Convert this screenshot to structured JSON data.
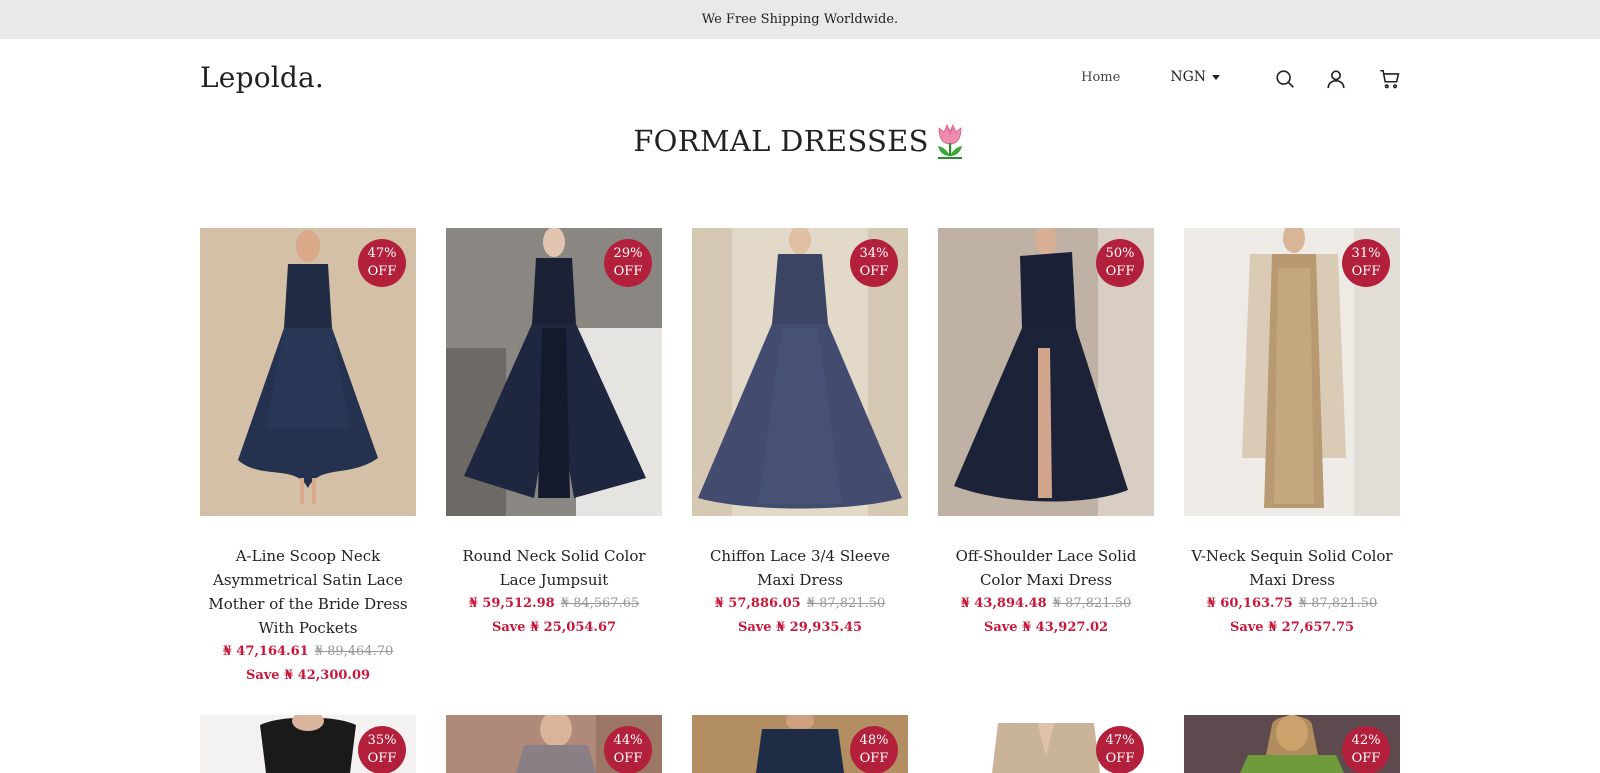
{
  "announcement": "We Free Shipping Worldwide.",
  "header": {
    "logo": "Lepolda.",
    "nav_home": "Home",
    "currency": "NGN",
    "icons": [
      "search-icon",
      "account-icon",
      "cart-icon"
    ]
  },
  "collection_title": "FORMAL DRESSES",
  "colors": {
    "badge": "#b3203c",
    "price": "#c8183a",
    "announcement_bg": "#e9e9e9"
  },
  "products": [
    {
      "badge_pct": "47%",
      "badge_off": "OFF",
      "title": "A-Line Scoop Neck Asymmetrical Satin Lace Mother of the Bride Dress With Pockets",
      "price": "₦ 47,164.61",
      "compare_price": "₦ 89,464.70",
      "save": "Save ₦ 42,300.09"
    },
    {
      "badge_pct": "29%",
      "badge_off": "OFF",
      "title": "Round Neck Solid Color Lace Jumpsuit",
      "price": "₦ 59,512.98",
      "compare_price": "₦ 84,567.65",
      "save": "Save ₦ 25,054.67"
    },
    {
      "badge_pct": "34%",
      "badge_off": "OFF",
      "title": "Chiffon Lace 3/4 Sleeve Maxi Dress",
      "price": "₦ 57,886.05",
      "compare_price": "₦ 87,821.50",
      "save": "Save ₦ 29,935.45"
    },
    {
      "badge_pct": "50%",
      "badge_off": "OFF",
      "title": "Off-Shoulder Lace Solid Color Maxi Dress",
      "price": "₦ 43,894.48",
      "compare_price": "₦ 87,821.50",
      "save": "Save ₦ 43,927.02"
    },
    {
      "badge_pct": "31%",
      "badge_off": "OFF",
      "title": "V-Neck Sequin Solid Color Maxi Dress",
      "price": "₦ 60,163.75",
      "compare_price": "₦ 87,821.50",
      "save": "Save ₦ 27,657.75"
    }
  ],
  "products_row2": [
    {
      "badge_pct": "35%",
      "badge_off": "OFF"
    },
    {
      "badge_pct": "44%",
      "badge_off": "OFF"
    },
    {
      "badge_pct": "48%",
      "badge_off": "OFF"
    },
    {
      "badge_pct": "47%",
      "badge_off": "OFF"
    },
    {
      "badge_pct": "42%",
      "badge_off": "OFF"
    }
  ]
}
